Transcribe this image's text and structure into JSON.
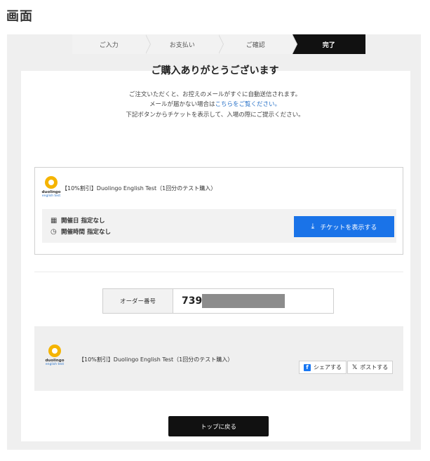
{
  "screen_label": "画面",
  "steps": [
    {
      "label": "ご入力",
      "active": false
    },
    {
      "label": "お支払い",
      "active": false
    },
    {
      "label": "ご確認",
      "active": false
    },
    {
      "label": "完了",
      "active": true
    }
  ],
  "confirmation": {
    "title": "ご購入ありがとうございます",
    "line1": "ご注文いただくと、お控えのメールがすぐに自動送信されます。",
    "line2_prefix": "メールが届かない場合は",
    "line2_link": "こちらをご覧ください。",
    "line3": "下記ボタンからチケットを表示して、入場の際にご提示ください。"
  },
  "ticket": {
    "logo_text": "duolingo",
    "logo_sub": "english test",
    "name": "【10%割引】Duolingo English Test（1回分のテスト購入）",
    "date_label": "開催日 指定なし",
    "time_label": "開催時間 指定なし",
    "show_button": "チケットを表示する",
    "icons": {
      "date": "calendar-icon",
      "time": "clock-icon",
      "download": "download-icon"
    }
  },
  "order": {
    "label": "オーダー番号",
    "value_visible": "739"
  },
  "share": {
    "logo_text": "duolingo",
    "logo_sub": "english test",
    "name": "【10%割引】Duolingo English Test（1回分のテスト購入）",
    "facebook_label": "シェアする",
    "x_label": "ポストする"
  },
  "footer": {
    "top_button": "トップに戻る"
  },
  "colors": {
    "accent_blue": "#1a73e8",
    "link_blue": "#2a73c9",
    "active_step": "#111111",
    "brand_yellow": "#f5b400",
    "facebook_blue": "#1877f2"
  }
}
